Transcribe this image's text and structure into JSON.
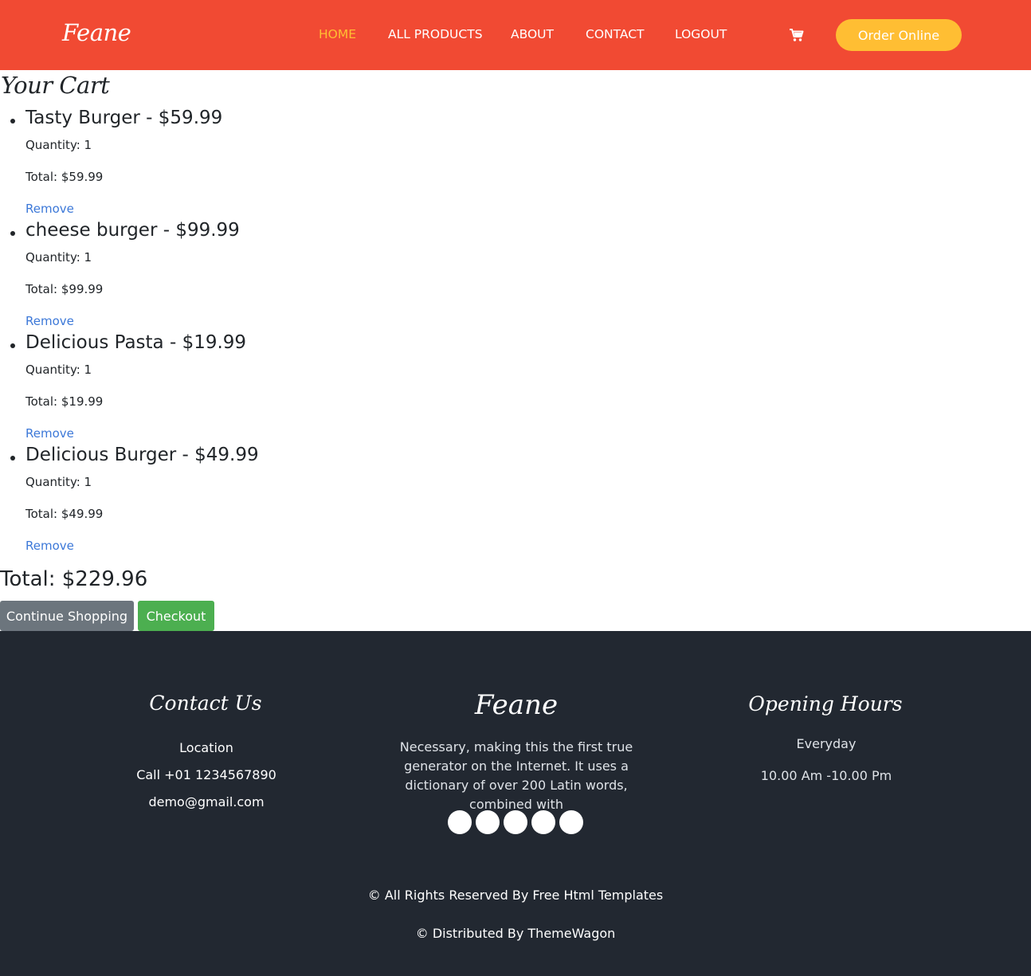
{
  "header": {
    "brand": "Feane",
    "nav": [
      {
        "label": "HOME",
        "active": true
      },
      {
        "label": "ALL PRODUCTS",
        "active": false
      },
      {
        "label": "ABOUT",
        "active": false
      },
      {
        "label": "CONTACT",
        "active": false
      },
      {
        "label": "LOGOUT",
        "active": false
      }
    ],
    "cart_icon": "cart-icon",
    "order_label": "Order Online"
  },
  "cart": {
    "title": "Your Cart",
    "items": [
      {
        "name": "Tasty Burger - $59.99",
        "quantity": "Quantity: 1",
        "total": "Total: $59.99",
        "remove": "Remove"
      },
      {
        "name": "cheese burger - $99.99",
        "quantity": "Quantity: 1",
        "total": "Total: $99.99",
        "remove": "Remove"
      },
      {
        "name": "Delicious Pasta - $19.99",
        "quantity": "Quantity: 1",
        "total": "Total: $19.99",
        "remove": "Remove"
      },
      {
        "name": "Delicious Burger - $49.99",
        "quantity": "Quantity: 1",
        "total": "Total: $49.99",
        "remove": "Remove"
      }
    ],
    "grand_total": "Total: $229.96",
    "continue_label": "Continue Shopping",
    "checkout_label": "Checkout"
  },
  "footer": {
    "contact": {
      "heading": "Contact Us",
      "location": "Location",
      "phone": "Call +01 1234567890",
      "email": "demo@gmail.com"
    },
    "brand": "Feane",
    "description": "Necessary, making this the first true generator on the Internet. It uses a dictionary of over 200 Latin words, combined with",
    "hours": {
      "heading": "Opening Hours",
      "days": "Everyday",
      "time": "10.00 Am -10.00 Pm"
    },
    "copyright": "© All Rights Reserved By Free Html Templates",
    "distributed": "© Distributed By ThemeWagon"
  },
  "colors": {
    "header_bg": "#f14a33",
    "accent": "#ffbe33",
    "footer_bg": "#222831",
    "link": "#3c78d8",
    "checkout_bg": "#4caf50",
    "continue_bg": "#6c757d"
  }
}
